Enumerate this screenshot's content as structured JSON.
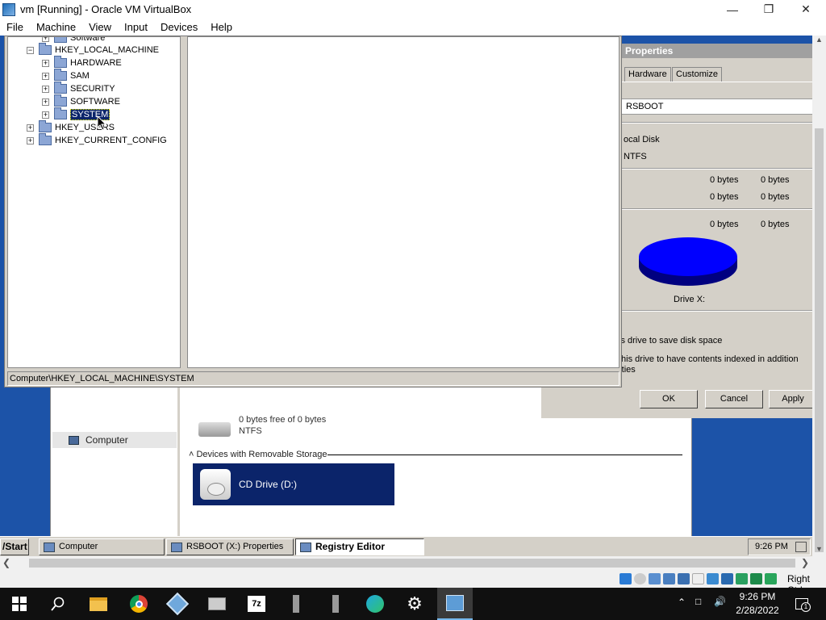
{
  "host_window": {
    "title": "vm [Running] - Oracle VM VirtualBox",
    "menu": [
      "File",
      "Machine",
      "View",
      "Input",
      "Devices",
      "Help"
    ]
  },
  "registry_editor": {
    "tree": [
      {
        "label": "Software",
        "indent": 1,
        "has_expander": true
      },
      {
        "label": "HKEY_LOCAL_MACHINE",
        "indent": 0,
        "has_expander": true,
        "expanded": true
      },
      {
        "label": "HARDWARE",
        "indent": 1,
        "has_expander": true
      },
      {
        "label": "SAM",
        "indent": 1,
        "has_expander": true
      },
      {
        "label": "SECURITY",
        "indent": 1,
        "has_expander": true
      },
      {
        "label": "SOFTWARE",
        "indent": 1,
        "has_expander": true
      },
      {
        "label": "SYSTEM",
        "indent": 1,
        "has_expander": true,
        "selected": true
      },
      {
        "label": "HKEY_USERS",
        "indent": 0,
        "has_expander": true
      },
      {
        "label": "HKEY_CURRENT_CONFIG",
        "indent": 0,
        "has_expander": true
      }
    ],
    "status_path": "Computer\\HKEY_LOCAL_MACHINE\\SYSTEM"
  },
  "properties_dialog": {
    "title": "Properties",
    "tabs": [
      "Hardware",
      "Customize"
    ],
    "name_value": "RSBOOT",
    "type_label": "ocal Disk",
    "fs_label": "NTFS",
    "used": [
      "0 bytes",
      "0 bytes"
    ],
    "free": [
      "0 bytes",
      "0 bytes"
    ],
    "capacity": [
      "0 bytes",
      "0 bytes"
    ],
    "drive_label": "Drive X:",
    "compress_text": "is drive to save disk space",
    "index_text_1": "this drive to have contents indexed in addition",
    "index_text_2": "rties",
    "buttons": {
      "ok": "OK",
      "cancel": "Cancel",
      "apply": "Apply"
    },
    "pie_color": "#0000ff"
  },
  "computer_window": {
    "nav_item": "Computer",
    "drive_x_free": "0 bytes free of 0 bytes",
    "drive_x_fs": "NTFS",
    "removable_header": "Devices with Removable Storage",
    "cd_drive": "CD Drive (D:)"
  },
  "guest_taskbar": {
    "start": "Start",
    "tasks": [
      {
        "label": "Computer",
        "active": false
      },
      {
        "label": "RSBOOT (X:) Properties",
        "active": false
      },
      {
        "label": "Registry Editor",
        "active": true
      }
    ],
    "clock": "9:26 PM"
  },
  "vbox_status": {
    "host_key": "Right Ctrl"
  },
  "windows_taskbar": {
    "time": "9:26 PM",
    "date": "2/28/2022",
    "notification_count": "1"
  }
}
